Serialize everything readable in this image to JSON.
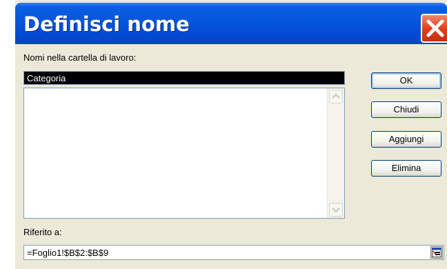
{
  "window": {
    "title": "Definisci nome",
    "close_icon": "close-x-icon"
  },
  "names_label": "Nomi nella cartella di lavoro:",
  "name_value": "Categoria",
  "names_list": [],
  "buttons": {
    "ok": "OK",
    "close": "Chiudi",
    "add": "Aggiungi",
    "delete": "Elimina"
  },
  "ref_label": "Riferito a:",
  "ref_value": "=Foglio1!$B$2:$B$9",
  "ref_button_icon": "collapse-dialog-icon",
  "colors": {
    "title_bar": "#0655dd",
    "close_button": "#e0401d",
    "dialog_bg": "#ece9d8",
    "selected_bg": "#000000"
  }
}
